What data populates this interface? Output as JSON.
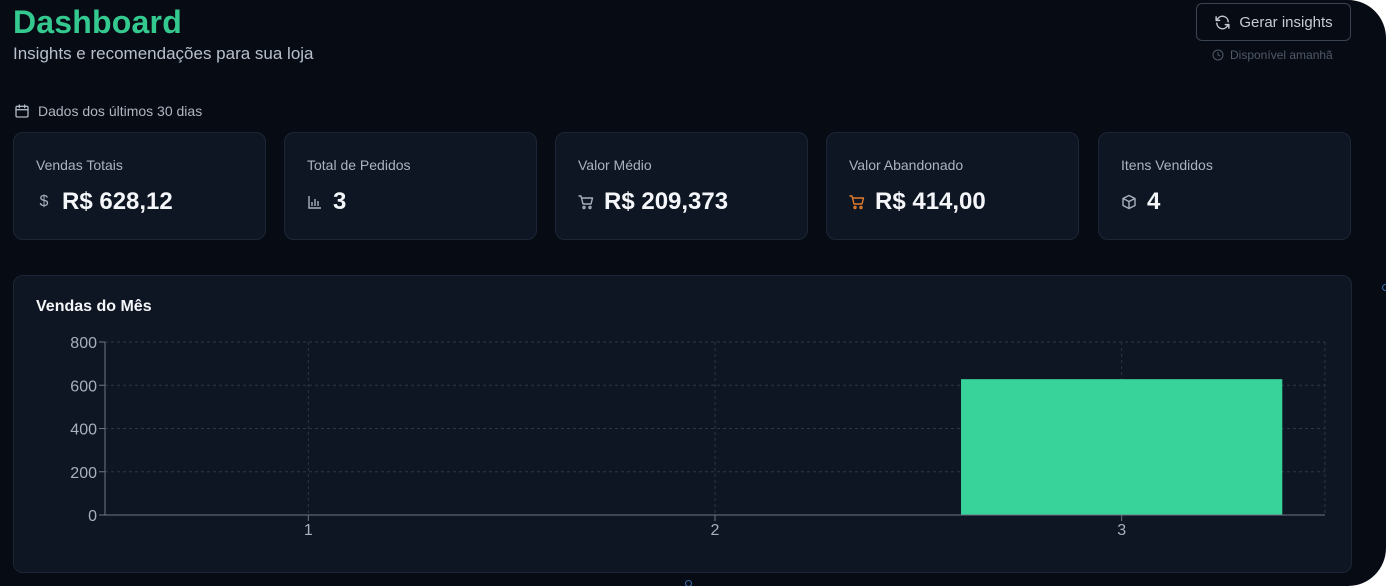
{
  "header": {
    "title": "Dashboard",
    "subtitle": "Insights e recomendações para sua loja",
    "insights_button_label": "Gerar insights",
    "availability_text": "Disponível amanhã"
  },
  "period_label": "Dados dos últimos 30 dias",
  "stats": [
    {
      "label": "Vendas Totais",
      "value": "R$ 628,12",
      "icon": "dollar-icon"
    },
    {
      "label": "Total de Pedidos",
      "value": "3",
      "icon": "bar-chart-icon"
    },
    {
      "label": "Valor Médio",
      "value": "R$ 209,373",
      "icon": "cart-icon"
    },
    {
      "label": "Valor Abandonado",
      "value": "R$ 414,00",
      "icon": "cart-icon",
      "icon_color": "#e07b2c"
    },
    {
      "label": "Itens Vendidos",
      "value": "4",
      "icon": "package-icon"
    }
  ],
  "colors": {
    "accent": "#34c98f",
    "bar": "#38d39b",
    "background": "#070b14",
    "card": "#0e1623"
  },
  "chart_data": {
    "type": "bar",
    "title": "Vendas do Mês",
    "categories": [
      "1",
      "2",
      "3"
    ],
    "values": [
      0,
      0,
      628.12
    ],
    "ylim": [
      0,
      800
    ],
    "yticks": [
      0,
      200,
      400,
      600,
      800
    ],
    "xlabel": "",
    "ylabel": "",
    "grid": true
  }
}
